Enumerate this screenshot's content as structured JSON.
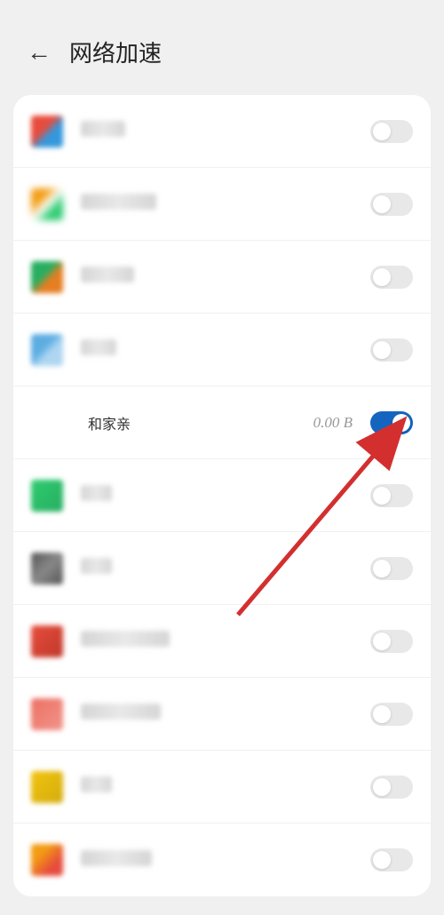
{
  "header": {
    "title": "网络加速"
  },
  "featured_app": {
    "name": "和家亲",
    "data_usage": "0.00 B",
    "toggle_state": "on"
  },
  "apps": [
    {
      "id": "app-1",
      "icon_class": "icon-1",
      "text_width": "bt-50",
      "toggle": "off"
    },
    {
      "id": "app-2",
      "icon_class": "icon-2",
      "text_width": "bt-85",
      "toggle": "off"
    },
    {
      "id": "app-3",
      "icon_class": "icon-3",
      "text_width": "bt-60",
      "toggle": "off"
    },
    {
      "id": "app-4",
      "icon_class": "icon-4",
      "text_width": "bt-40",
      "toggle": "off"
    },
    {
      "id": "featured",
      "featured": true
    },
    {
      "id": "app-6",
      "icon_class": "icon-6",
      "text_width": "bt-35",
      "toggle": "off"
    },
    {
      "id": "app-7",
      "icon_class": "icon-7",
      "text_width": "bt-35",
      "toggle": "off"
    },
    {
      "id": "app-8",
      "icon_class": "icon-8",
      "text_width": "bt-100",
      "toggle": "off"
    },
    {
      "id": "app-9",
      "icon_class": "icon-9",
      "text_width": "bt-90",
      "toggle": "off"
    },
    {
      "id": "app-10",
      "icon_class": "icon-10",
      "text_width": "bt-35",
      "toggle": "off"
    },
    {
      "id": "app-11",
      "icon_class": "icon-11",
      "text_width": "bt-80",
      "toggle": "off"
    }
  ]
}
